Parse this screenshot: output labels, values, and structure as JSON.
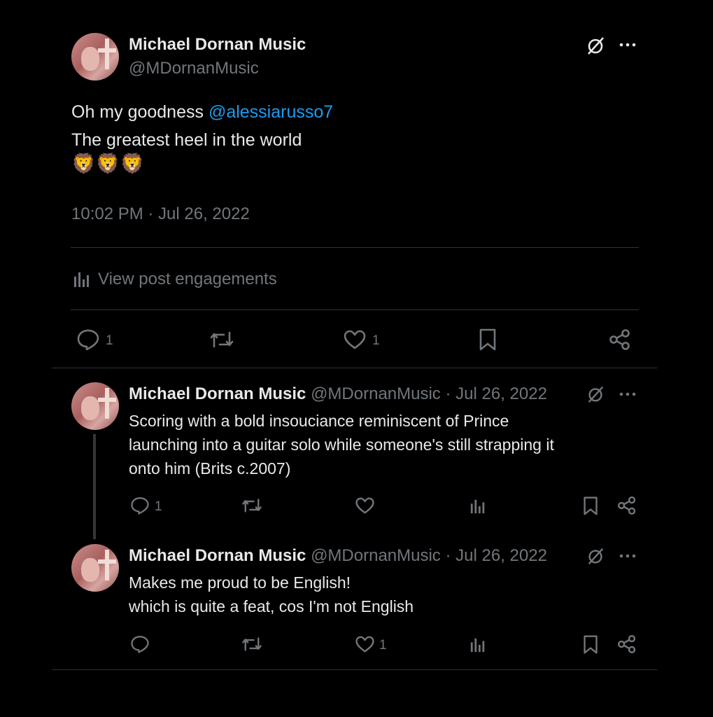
{
  "main_post": {
    "display_name": "Michael Dornan Music",
    "handle": "@MDornanMusic",
    "text_line1_prefix": "Oh my goodness ",
    "mention": "@alessiarusso7",
    "text_line2": "The greatest heel in the world",
    "emoji_line": "🦁🦁🦁",
    "timestamp": "10:02 PM · Jul 26, 2022",
    "engagements_label": "View post engagements",
    "reply_count": "1",
    "like_count": "1"
  },
  "replies": [
    {
      "display_name": "Michael Dornan Music",
      "handle": "@MDornanMusic",
      "date": "· Jul 26, 2022",
      "text_lines": [
        "Scoring with a bold insouciance reminiscent of Prince",
        "launching into a guitar solo while someone's still strapping it",
        "onto him (Brits c.2007)"
      ],
      "reply_count": "1",
      "like_count": ""
    },
    {
      "display_name": "Michael Dornan Music",
      "handle": "@MDornanMusic",
      "date": "· Jul 26, 2022",
      "text_lines": [
        "Makes me proud to be English!",
        "which is quite a feat, cos I'm not English"
      ],
      "reply_count": "",
      "like_count": "1"
    }
  ],
  "icons": {
    "grok": "grok-icon",
    "more": "more-icon",
    "reply": "reply-icon",
    "repost": "repost-icon",
    "like": "like-icon",
    "bookmark": "bookmark-icon",
    "share": "share-icon",
    "analytics": "analytics-icon"
  },
  "colors": {
    "background": "#000000",
    "text": "#e7e9ea",
    "muted": "#71767b",
    "link": "#1d9bf0",
    "divider": "#2f3336"
  }
}
